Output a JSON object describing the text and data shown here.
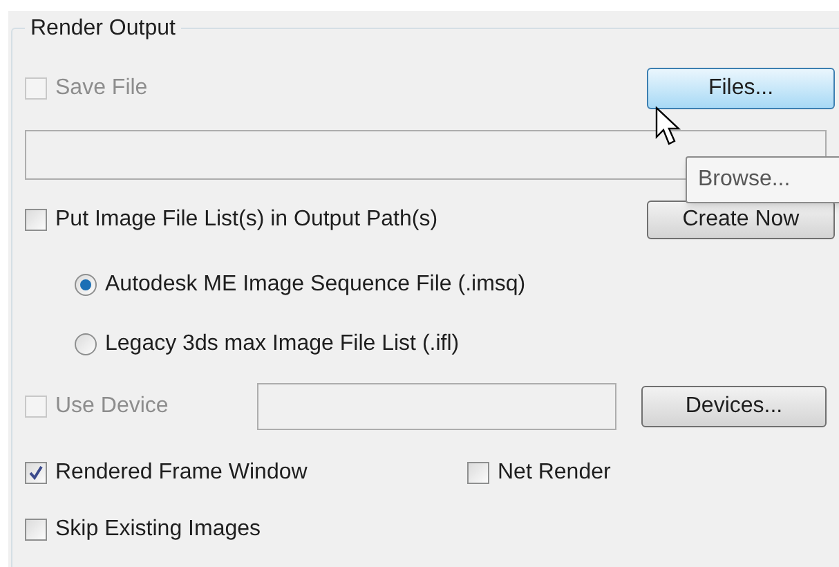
{
  "group": {
    "title": "Render Output"
  },
  "save_file": {
    "label": "Save File",
    "checked": false,
    "disabled": true
  },
  "files_button": {
    "label": "Files...",
    "hovered": true
  },
  "tooltip": {
    "text": "Browse..."
  },
  "image_list": {
    "label": "Put Image File List(s) in Output Path(s)",
    "checked": false,
    "disabled": false
  },
  "create_now_button": {
    "label": "Create Now",
    "hovered": false
  },
  "list_formats": [
    {
      "label": "Autodesk ME Image Sequence File (.imsq)",
      "selected": true
    },
    {
      "label": "Legacy 3ds max Image File List (.ifl)",
      "selected": false
    }
  ],
  "use_device": {
    "label": "Use Device",
    "checked": false,
    "disabled": true
  },
  "devices_button": {
    "label": "Devices...",
    "hovered": false
  },
  "options": [
    {
      "label": "Rendered Frame Window",
      "checked": true,
      "disabled": false
    },
    {
      "label": "Net Render",
      "checked": false,
      "disabled": false
    },
    {
      "label": "Skip Existing Images",
      "checked": false,
      "disabled": false
    }
  ]
}
